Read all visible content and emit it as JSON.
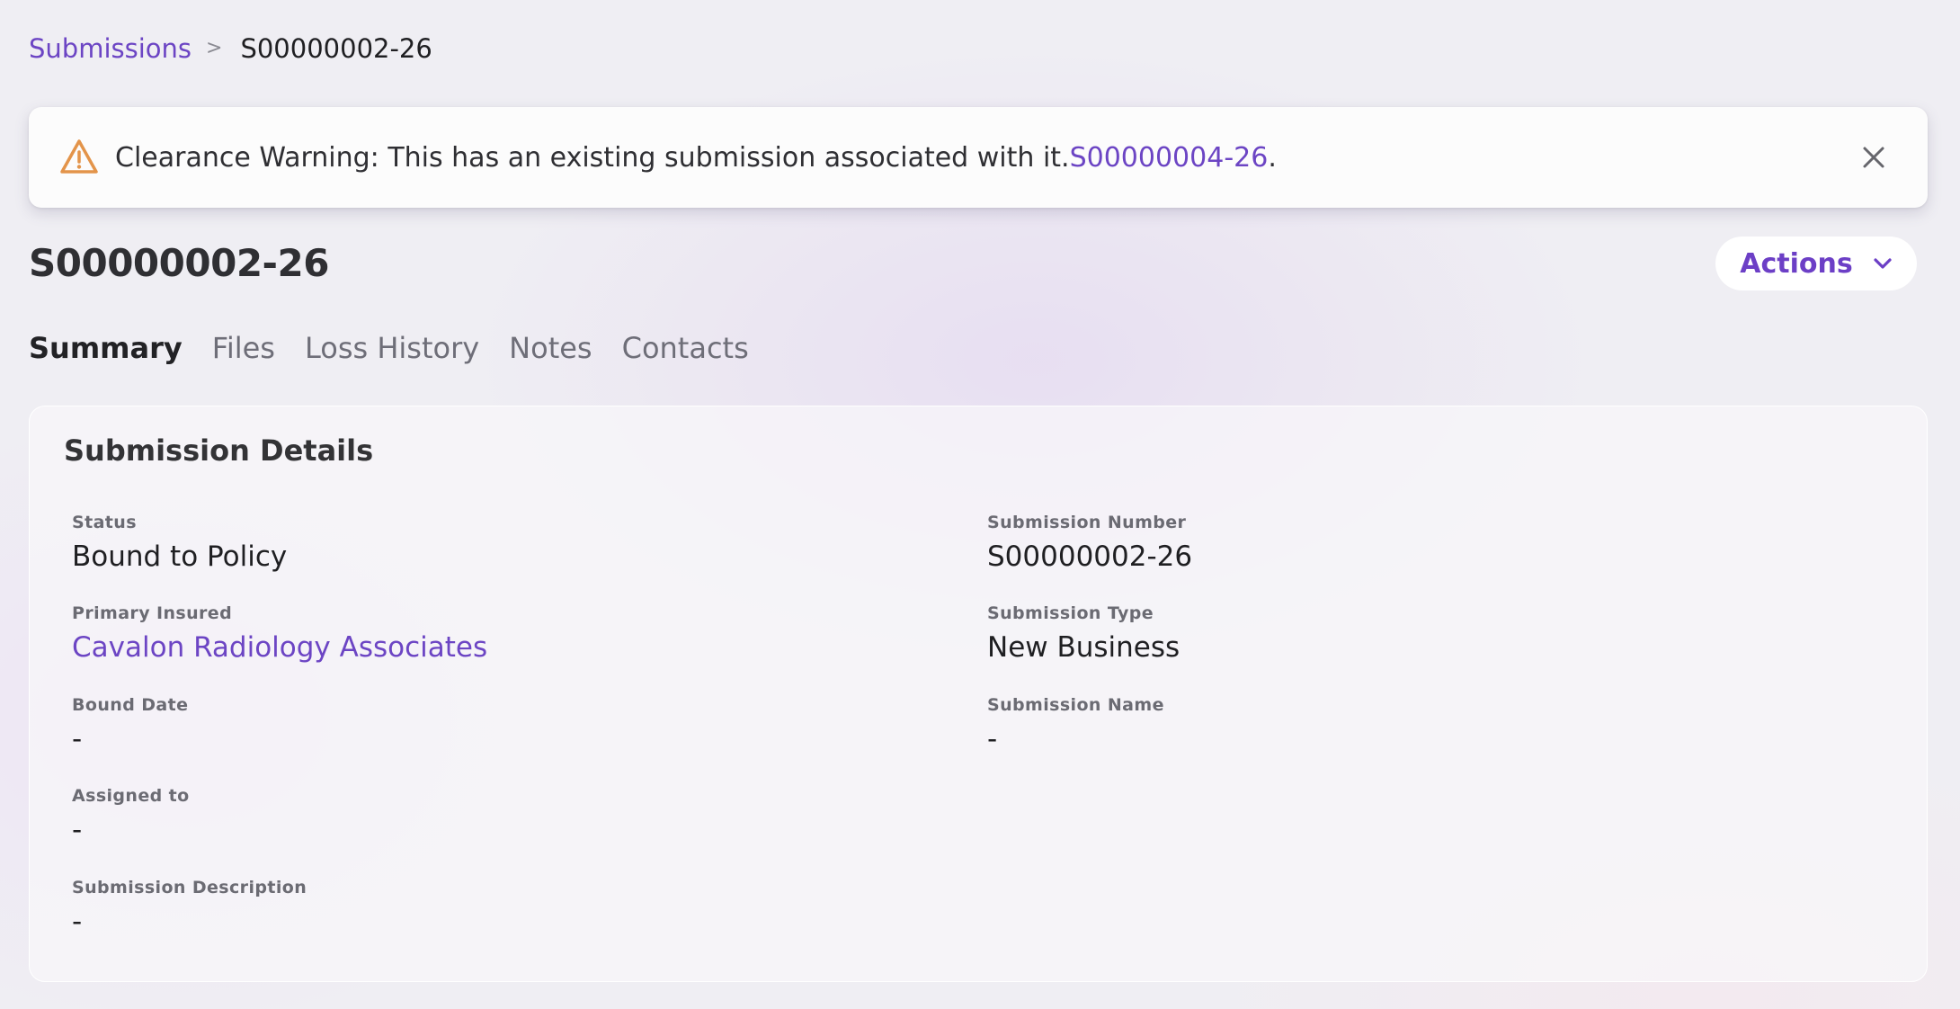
{
  "breadcrumb": {
    "parent": "Submissions",
    "separator": ">",
    "current": "S00000002-26"
  },
  "banner": {
    "message": "Clearance Warning: This has an existing submission associated with it. ",
    "link_text": "S00000004-26",
    "suffix": ".",
    "icon": "warning-icon",
    "close_icon": "close-icon",
    "icon_color": "#e3944a"
  },
  "header": {
    "title": "S00000002-26",
    "actions_label": "Actions"
  },
  "tabs": [
    {
      "label": "Summary",
      "active": true
    },
    {
      "label": "Files",
      "active": false
    },
    {
      "label": "Loss History",
      "active": false
    },
    {
      "label": "Notes",
      "active": false
    },
    {
      "label": "Contacts",
      "active": false
    }
  ],
  "details": {
    "title": "Submission Details",
    "status": {
      "label": "Status",
      "value": "Bound to Policy"
    },
    "primary_insured": {
      "label": "Primary Insured",
      "value": "Cavalon Radiology Associates"
    },
    "bound_date": {
      "label": "Bound Date",
      "value": "-"
    },
    "assigned_to": {
      "label": "Assigned to",
      "value": "-"
    },
    "description": {
      "label": "Submission Description",
      "value": "-"
    },
    "number": {
      "label": "Submission Number",
      "value": "S00000002-26"
    },
    "type": {
      "label": "Submission Type",
      "value": "New Business"
    },
    "name": {
      "label": "Submission Name",
      "value": "-"
    }
  },
  "colors": {
    "accent": "#6c45c4",
    "warning": "#e3944a",
    "background": "#efeef3"
  }
}
